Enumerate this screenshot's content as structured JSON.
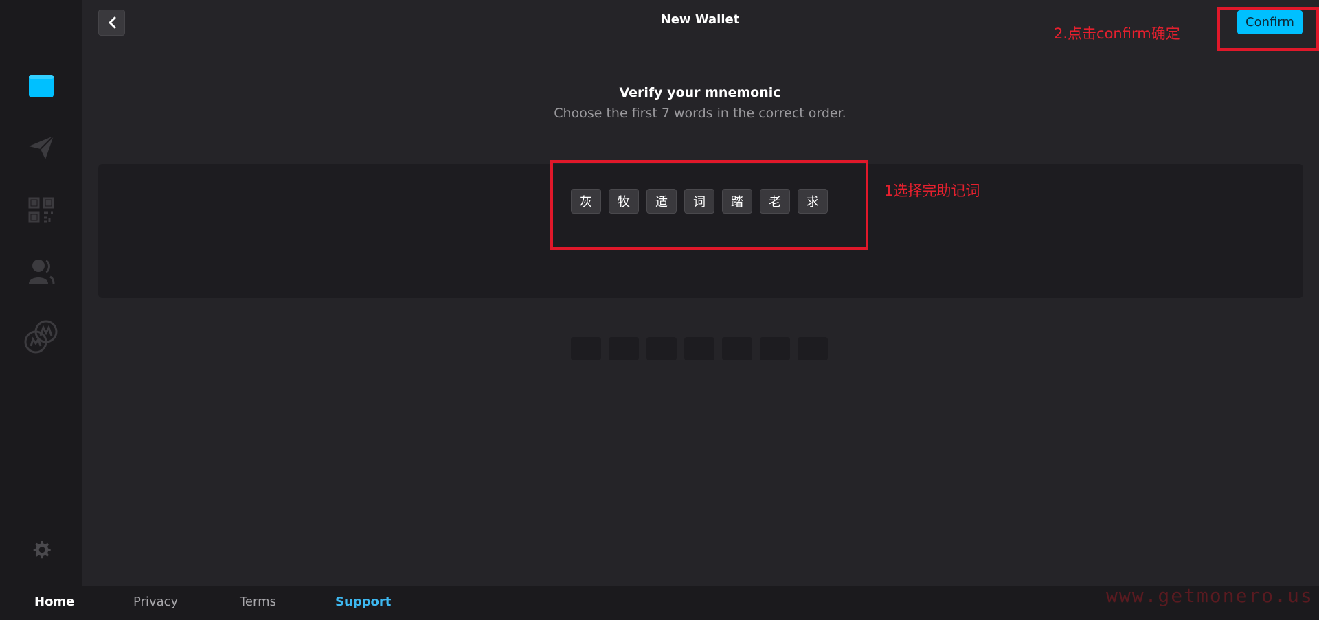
{
  "header": {
    "title": "New Wallet",
    "confirm_label": "Confirm"
  },
  "annotations": {
    "step2": "2.点击confirm确定",
    "step1": "1选择完助记词"
  },
  "verify": {
    "title": "Verify your mnemonic",
    "subtitle": "Choose the first 7 words in the correct order."
  },
  "selected_words": [
    "灰",
    "牧",
    "适",
    "词",
    "踏",
    "老",
    "求"
  ],
  "empty_slot_count": 7,
  "sidebar": {
    "items": [
      {
        "name": "wallet-icon",
        "active": true
      },
      {
        "name": "send-icon",
        "active": false
      },
      {
        "name": "qr-code-icon",
        "active": false
      },
      {
        "name": "contacts-icon",
        "active": false
      },
      {
        "name": "monero-exchange-icon",
        "active": false
      },
      {
        "name": "settings-gear-icon",
        "active": false
      }
    ]
  },
  "footer": {
    "home": "Home",
    "privacy": "Privacy",
    "terms": "Terms",
    "support": "Support"
  },
  "watermark": "www.getmonero.us",
  "colors": {
    "accent": "#00c0ff",
    "annotation": "#e0182a",
    "support_link": "#3eb8f0"
  }
}
